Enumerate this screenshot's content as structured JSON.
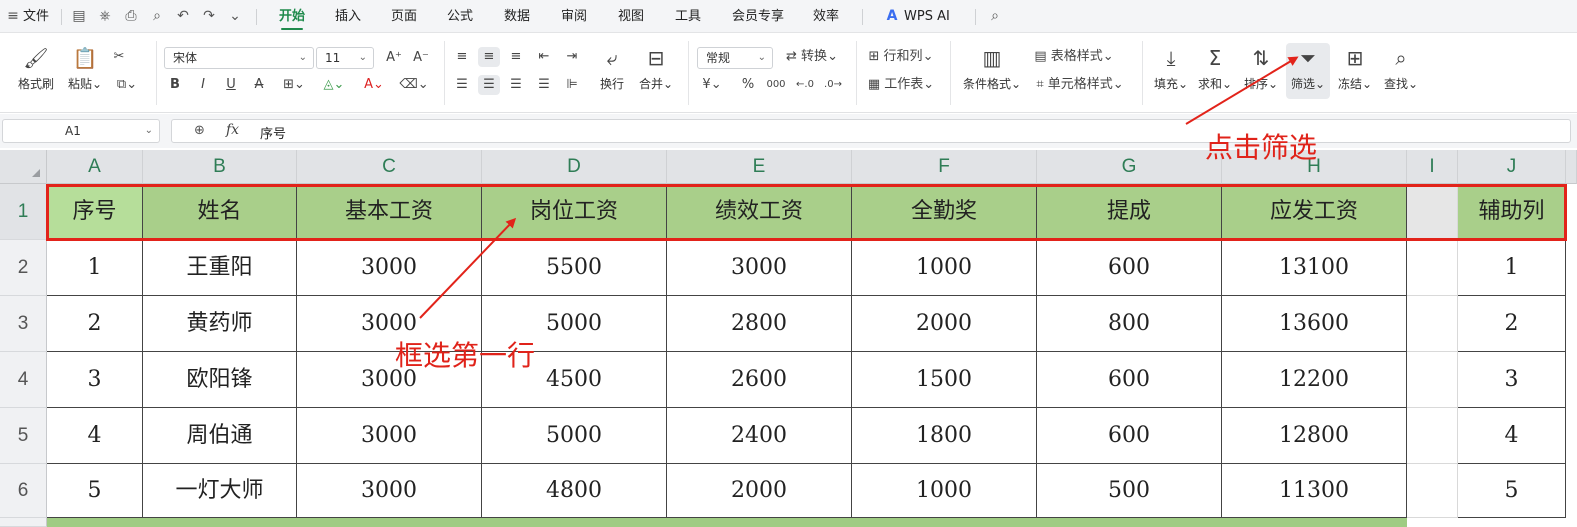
{
  "menubar": {
    "file_label": "文件",
    "tabs": [
      "开始",
      "插入",
      "页面",
      "公式",
      "数据",
      "审阅",
      "视图",
      "工具",
      "会员专享",
      "效率"
    ],
    "active_tab": "开始",
    "wps_ai_label": "WPS AI"
  },
  "ribbon": {
    "format_painter": "格式刷",
    "paste": "粘贴",
    "font_name": "宋体",
    "font_size": "11",
    "wrap": "换行",
    "merge": "合并",
    "number_format": "常规",
    "convert": "转换",
    "row_col": "行和列",
    "worksheet": "工作表",
    "cond_format": "条件格式",
    "table_style": "表格样式",
    "cell_style": "单元格样式",
    "fill": "填充",
    "sum": "求和",
    "sort": "排序",
    "filter": "筛选",
    "freeze": "冻结",
    "find": "查找",
    "currency_symbol": "¥",
    "percent_symbol": "%",
    "thousands_symbol": "000"
  },
  "formula_bar": {
    "name_box": "A1",
    "fx": "fx",
    "value": "序号"
  },
  "sheet": {
    "columns": [
      "A",
      "B",
      "C",
      "D",
      "E",
      "F",
      "G",
      "H",
      "I",
      "J"
    ],
    "rows": [
      "1",
      "2",
      "3",
      "4",
      "5",
      "6"
    ],
    "header": [
      "序号",
      "姓名",
      "基本工资",
      "岗位工资",
      "绩效工资",
      "全勤奖",
      "提成",
      "应发工资",
      "",
      "辅助列"
    ],
    "data": [
      [
        "1",
        "王重阳",
        "3000",
        "5500",
        "3000",
        "1000",
        "600",
        "13100",
        "",
        "1"
      ],
      [
        "2",
        "黄药师",
        "3000",
        "5000",
        "2800",
        "2000",
        "800",
        "13600",
        "",
        "2"
      ],
      [
        "3",
        "欧阳锋",
        "3000",
        "4500",
        "2600",
        "1500",
        "600",
        "12200",
        "",
        "3"
      ],
      [
        "4",
        "周伯通",
        "3000",
        "5000",
        "2400",
        "1800",
        "600",
        "12800",
        "",
        "4"
      ],
      [
        "5",
        "一灯大师",
        "3000",
        "4800",
        "2000",
        "1000",
        "500",
        "11300",
        "",
        "5"
      ]
    ]
  },
  "annotations": {
    "click_filter": "点击筛选",
    "select_first_row": "框选第一行"
  },
  "colors": {
    "accent": "#1f8a4c",
    "header_fill": "#a9cf8a",
    "annotation_red": "#e2231a"
  }
}
